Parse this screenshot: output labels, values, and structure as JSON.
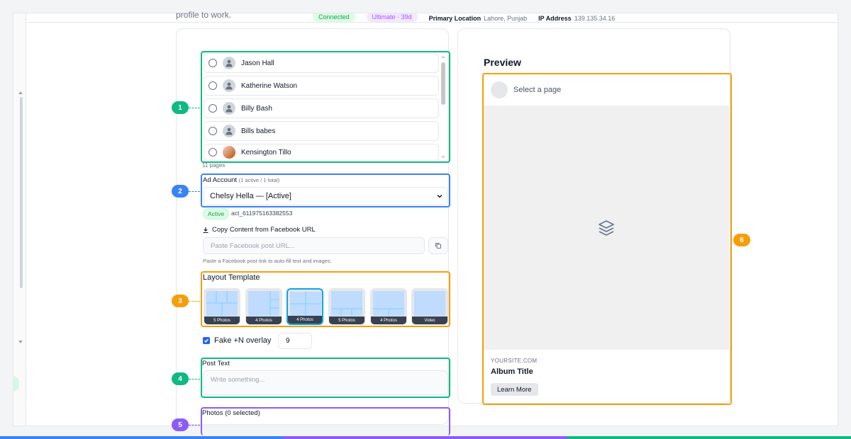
{
  "topbar": {
    "connected": "Connected",
    "plan": "Ultimate · 39d",
    "location_label": "Primary Location",
    "location_value": "Lahore, Punjab",
    "ip_label": "IP Address",
    "ip_value": "139.135.34.16"
  },
  "intro_text": "profile to work.",
  "pages": {
    "items": [
      {
        "name": "Jason Hall",
        "avatar": "person-icon"
      },
      {
        "name": "Katherine Watson",
        "avatar": "person-icon"
      },
      {
        "name": "Billy Bash",
        "avatar": "person-icon"
      },
      {
        "name": "Bills babes",
        "avatar": "person-icon"
      },
      {
        "name": "Kensington Tillo",
        "avatar": "photo-avatar"
      }
    ],
    "count_text": "11 pages"
  },
  "ad_account": {
    "label": "Ad Account",
    "summary": "(1 active / 1 total)",
    "selected": "Chelsy Hella — [Active]",
    "status": "Active",
    "account_id": "act_611975163382553"
  },
  "copy_content": {
    "title": "Copy Content from Facebook URL",
    "placeholder": "Paste Facebook post URL...",
    "hint": "Paste a Facebook post link to auto-fill text and images."
  },
  "layout": {
    "title": "Layout Template",
    "templates": [
      {
        "label": "5 Photos",
        "selected": false
      },
      {
        "label": "4 Photos",
        "selected": false
      },
      {
        "label": "4 Photos",
        "selected": true
      },
      {
        "label": "5 Photos",
        "selected": false
      },
      {
        "label": "4 Photos",
        "selected": false
      },
      {
        "label": "Video",
        "selected": false
      }
    ]
  },
  "overlay": {
    "label": "Fake +N overlay",
    "checked": true,
    "value": "9"
  },
  "post_text": {
    "label": "Post Text",
    "placeholder": "Write something..."
  },
  "photos": {
    "label": "Photos (0 selected)"
  },
  "preview": {
    "title": "Preview",
    "page_placeholder": "Select a page",
    "site": "YOURSITE.COM",
    "album_title": "Album Title",
    "cta": "Learn More",
    "image_icon": "layers-icon"
  },
  "markers": [
    "1",
    "2",
    "3",
    "4",
    "5",
    "6"
  ],
  "colors": {
    "marker_green": "#10b981",
    "marker_blue": "#3b82f6",
    "marker_orange": "#f59e0b",
    "marker_purple": "#8b5cf6",
    "selected_tile": "#0ea5e9",
    "tile_fill": "#bfdbfe"
  }
}
